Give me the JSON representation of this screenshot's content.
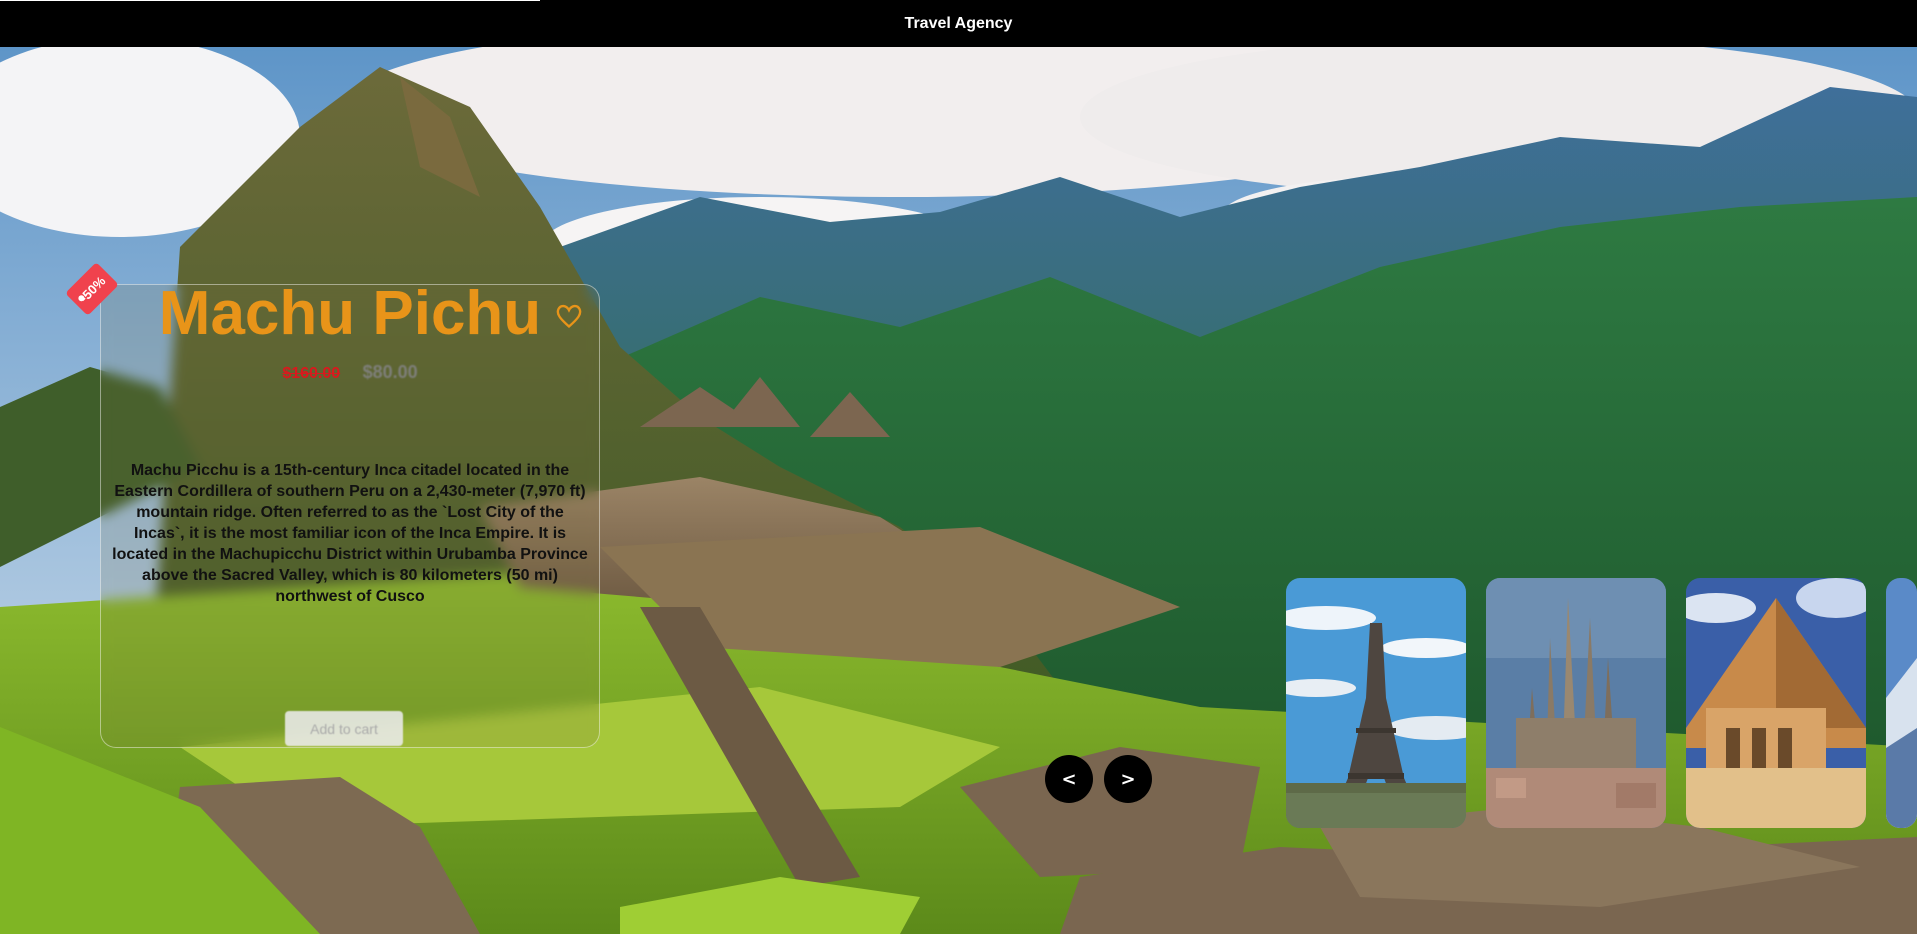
{
  "header": {
    "title": "Travel Agency"
  },
  "hero": {
    "badge": "-50%",
    "title": "Machu Pichu",
    "old_price": "$160.00",
    "new_price": "$80.00",
    "description": "Machu Picchu is a 15th-century Inca citadel located in the Eastern Cordillera of southern Peru on a 2,430-meter (7,970 ft) mountain ridge. Often referred to as the `Lost City of the Incas`, it is the most familiar icon of the Inca Empire. It is located in the Machupicchu District within Urubamba Province above the Sacred Valley, which is 80 kilometers (50 mi) northwest of Cusco",
    "cart_label": "Add to cart",
    "favorite_icon": "heart-icon",
    "prev_label": "<",
    "next_label": ">"
  },
  "carousel": {
    "items": [
      {
        "name": "eiffel-tower"
      },
      {
        "name": "sagrada-familia"
      },
      {
        "name": "pyramid"
      },
      {
        "name": "next-destination"
      }
    ]
  },
  "colors": {
    "accent": "#e89419",
    "discount": "#f0424d",
    "old_price": "#d9191d"
  }
}
